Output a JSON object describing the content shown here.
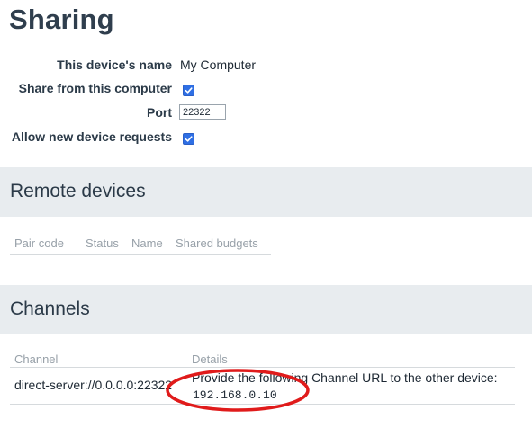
{
  "page": {
    "title": "Sharing"
  },
  "settings": {
    "device_name": {
      "label": "This device's name",
      "value": "My Computer"
    },
    "share_from_computer": {
      "label": "Share from this computer",
      "checked": true
    },
    "port": {
      "label": "Port",
      "value": "22322"
    },
    "allow_requests": {
      "label": "Allow new device requests",
      "checked": true
    }
  },
  "remote_devices": {
    "title": "Remote devices",
    "columns": [
      "Pair code",
      "Status",
      "Name",
      "Shared budgets"
    ],
    "rows": []
  },
  "channels": {
    "title": "Channels",
    "columns": [
      "Channel",
      "Details"
    ],
    "rows": [
      {
        "channel": "direct-server://0.0.0.0:22322",
        "details": "Provide the following Channel URL to the other device:",
        "url": "192.168.0.10"
      }
    ]
  },
  "colors": {
    "accent": "#2f6fe4",
    "section_bg": "#e8ecef",
    "annotation": "#e01b1b"
  },
  "icons": {
    "checkbox_checked": "check-icon"
  }
}
